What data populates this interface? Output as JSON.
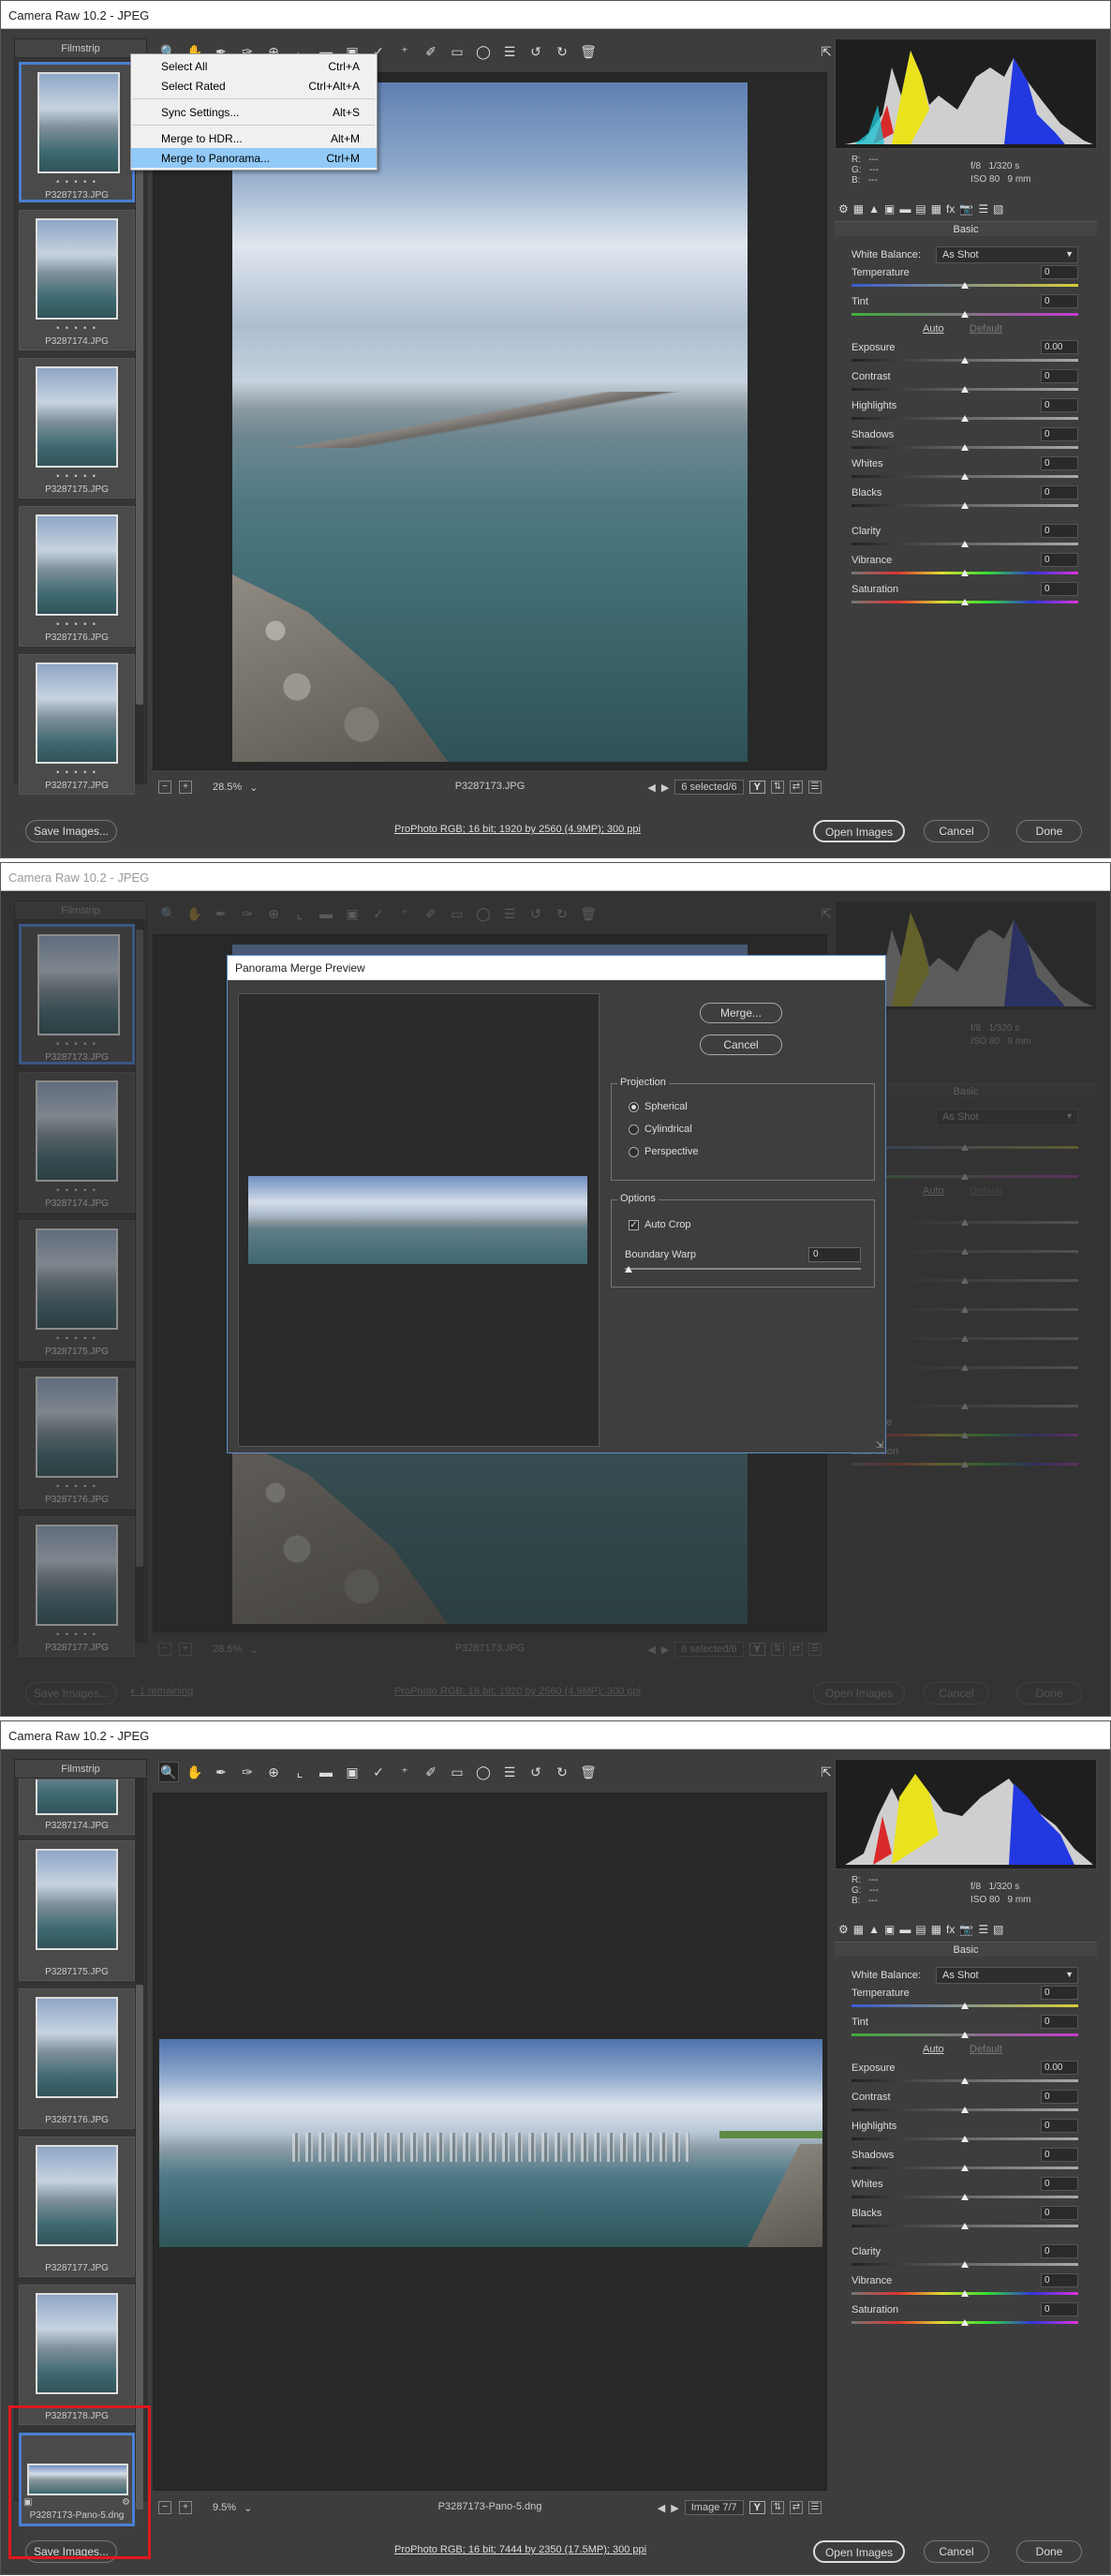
{
  "app_title": "Camera Raw 10.2  -  JPEG",
  "filmstrip_label": "Filmstrip",
  "toolbar_icons": [
    "zoom-icon",
    "hand-icon",
    "white-balance-icon",
    "color-sampler-icon",
    "targeted-adjust-icon",
    "crop-icon",
    "straighten-icon",
    "transform-icon",
    "spot-removal-icon",
    "red-eye-icon",
    "adjustment-brush-icon",
    "graduated-filter-icon",
    "radial-filter-icon",
    "preferences-icon",
    "rotate-ccw-icon",
    "rotate-cw-icon",
    "trash-icon"
  ],
  "panel": {
    "title": "Basic",
    "white_balance_label": "White Balance:",
    "white_balance_value": "As Shot",
    "auto": "Auto",
    "default": "Default",
    "sliders": [
      {
        "label": "Temperature",
        "value": "0"
      },
      {
        "label": "Tint",
        "value": "0"
      },
      {
        "label": "Exposure",
        "value": "0.00"
      },
      {
        "label": "Contrast",
        "value": "0"
      },
      {
        "label": "Highlights",
        "value": "0"
      },
      {
        "label": "Shadows",
        "value": "0"
      },
      {
        "label": "Whites",
        "value": "0"
      },
      {
        "label": "Blacks",
        "value": "0"
      },
      {
        "label": "Clarity",
        "value": "0"
      },
      {
        "label": "Vibrance",
        "value": "0"
      },
      {
        "label": "Saturation",
        "value": "0"
      }
    ],
    "readout": {
      "r": "R:",
      "g": "G:",
      "b": "B:",
      "dash": "---",
      "aperture": "f/8",
      "shutter": "1/320 s",
      "iso": "ISO 80",
      "focal": "9 mm"
    }
  },
  "screen1": {
    "film_items": [
      "P3287173.JPG",
      "P3287174.JPG",
      "P3287175.JPG",
      "P3287176.JPG",
      "P3287177.JPG"
    ],
    "dots": "• • • • •",
    "zoom": "28.5%",
    "filename": "P3287173.JPG",
    "selection": "6 selected/6",
    "color_profile": "ProPhoto RGB; 16 bit; 1920 by 2560 (4.9MP); 300 ppi",
    "menu": [
      {
        "label": "Select All",
        "shortcut": "Ctrl+A"
      },
      {
        "label": "Select Rated",
        "shortcut": "Ctrl+Alt+A"
      },
      {
        "label": "Sync Settings...",
        "shortcut": "Alt+S"
      },
      {
        "label": "Merge to HDR...",
        "shortcut": "Alt+M"
      },
      {
        "label": "Merge to Panorama...",
        "shortcut": "Ctrl+M"
      }
    ]
  },
  "screen2": {
    "remaining": "1 remaining",
    "dialog": {
      "title": "Panorama Merge Preview",
      "merge": "Merge...",
      "cancel": "Cancel",
      "projection_label": "Projection",
      "projections": [
        "Spherical",
        "Cylindrical",
        "Perspective"
      ],
      "selected_projection": "Spherical",
      "options_label": "Options",
      "auto_crop": "Auto Crop",
      "auto_crop_checked": true,
      "boundary_warp_label": "Boundary Warp",
      "boundary_warp_value": "0"
    }
  },
  "screen3": {
    "film_items": [
      "P3287174.JPG",
      "P3287175.JPG",
      "P3287176.JPG",
      "P3287177.JPG",
      "P3287178.JPG",
      "P3287173-Pano-5.dng"
    ],
    "zoom": "9.5%",
    "filename": "P3287173-Pano-5.dng",
    "image_counter": "Image 7/7",
    "color_profile": "ProPhoto RGB; 16 bit; 7444 by 2350 (17.5MP); 300 ppi"
  },
  "buttons": {
    "save_images": "Save Images...",
    "open_images": "Open Images",
    "cancel": "Cancel",
    "done": "Done"
  },
  "colors": {
    "highlight_red": "#e0191c",
    "selection_blue": "#4a7fd1",
    "menu_highlight": "#91c9f7"
  }
}
